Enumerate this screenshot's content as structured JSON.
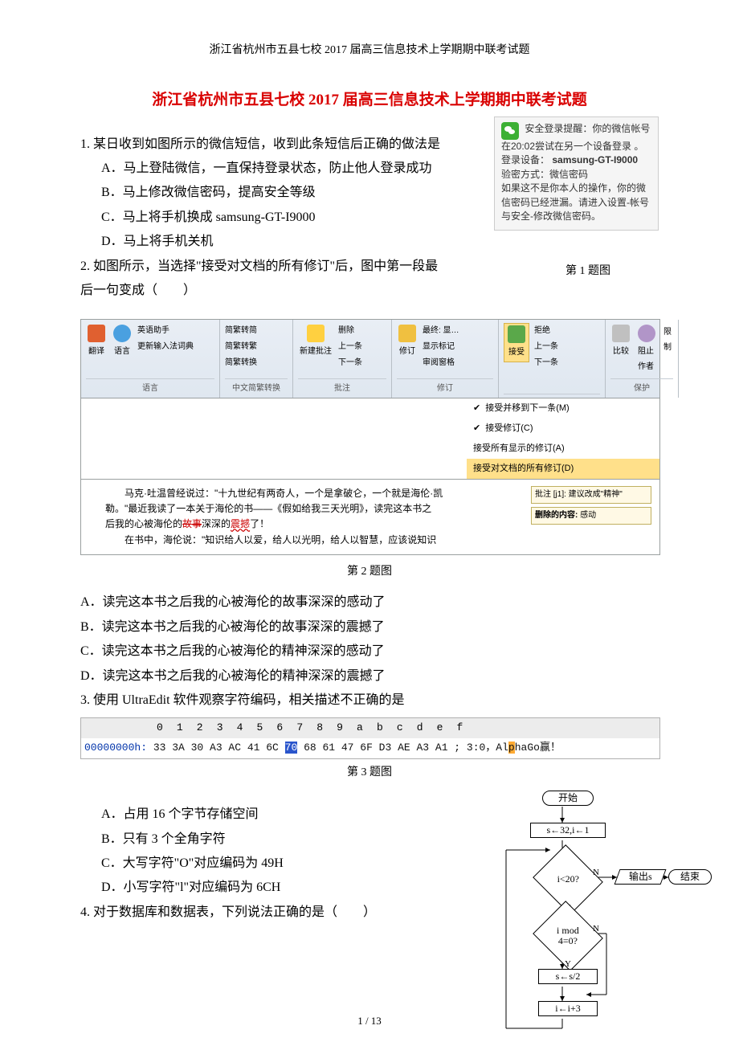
{
  "header": "浙江省杭州市五县七校 2017 届高三信息技术上学期期中联考试题",
  "title": "浙江省杭州市五县七校 2017 届高三信息技术上学期期中联考试题",
  "q1": {
    "stem": "1. 某日收到如图所示的微信短信，收到此条短信后正确的做法是",
    "A": "A．马上登陆微信，一直保持登录状态，防止他人登录成功",
    "B": "B．马上修改微信密码，提高安全等级",
    "C": "C．马上将手机换成 samsung-GT-I9000",
    "D": "D．马上将手机关机",
    "fig_caption": "第 1 题图"
  },
  "wechat": {
    "line1": "安全登录提醒：你的微信帐号在20:02尝试在另一个设备登录",
    "line1tail": "。",
    "deviceLabel": "登录设备：",
    "device": "samsung-GT-I9000",
    "method": "验密方式：微信密码",
    "warn": "如果这不是你本人的操作，你的微信密码已经泄漏。请进入设置-帐号与安全-修改微信密码。"
  },
  "q2": {
    "stem1": "2. 如图所示，当选择\"接受对文档的所有修订\"后，图中第一段最",
    "stem2": "后一句变成（　　）",
    "A": "A．读完这本书之后我的心被海伦的故事深深的感动了",
    "B": "B．读完这本书之后我的心被海伦的故事深深的震撼了",
    "C": "C．读完这本书之后我的心被海伦的精神深深的感动了",
    "D": "D．读完这本书之后我的心被海伦的精神深深的震撼了",
    "fig_caption": "第 2 题图"
  },
  "ribbon": {
    "translate": "翻译",
    "lang": "语言",
    "ime1": "英语助手",
    "ime2": "更新输入法词典",
    "grp_lang": "语言",
    "sc1": "简繁转简",
    "sc2": "简繁转繁",
    "sc3": "简繁转换",
    "grp_sc": "中文简繁转换",
    "newComment": "新建批注",
    "del": "删除",
    "prev": "上一条",
    "next": "下一条",
    "grp_comment": "批注",
    "track": "修订",
    "finalShow": "最终: 显…",
    "showMarkup": "显示标记",
    "reviewPane": "审阅窗格",
    "grp_track": "修订",
    "accept": "接受",
    "reject": "拒绝",
    "prev2": "上一条",
    "next2": "下一条",
    "compare": "比较",
    "block": "阻止作者",
    "restrict": "限制",
    "grp_protect": "保护",
    "menu1": "接受并移到下一条(M)",
    "menu2": "接受修订(C)",
    "menu3": "接受所有显示的修订(A)",
    "menu4": "接受对文档的所有修订(D)"
  },
  "docText": {
    "p1a": "马克·吐温曾经说过：\"十九世纪有两奇人，一个是拿破仑，一个就是海伦·凯",
    "p1b": "勒。\"最近我读了一本关于海伦的书——《假如给我三天光明》，读完这本书之",
    "p1c_pre": "后我的心被海伦的",
    "p1c_strike": "故事",
    "p1c_mid": "深深的",
    "p1c_wavy": "震撼",
    "p1c_end": "了！",
    "p2": "在书中，海伦说：\"知识给人以爱，给人以光明，给人以智慧，应该说知识",
    "balloon1": "批注 [j1]: 建议改成\"精神\"",
    "balloon2_label": "删除的内容:",
    "balloon2_val": "感动"
  },
  "q3": {
    "stem": "3. 使用 UltraEdit 软件观察字符编码，相关描述不正确的是",
    "ruler": "0  1  2  3  4  5  6  7  8  9  a  b  c  d  e  f",
    "addr": "00000000h:",
    "hex_before": " 33 3A 30 A3 AC 41 6C ",
    "hex_hl": "70",
    "hex_after": " 68 61 47 6F D3 AE A3 A1 ; ",
    "ascii_pre": "3:0，Al",
    "ascii_hl": "p",
    "ascii_post": "haGo赢！",
    "fig_caption": "第 3 题图",
    "A": "A．占用 16 个字节存储空间",
    "B": "B．只有 3 个全角字符",
    "C": "C．大写字符\"O\"对应编码为 49H",
    "D": "D．小写字符\"l\"对应编码为 6CH"
  },
  "q4": {
    "stem": "4. 对于数据库和数据表，下列说法正确的是（　　）"
  },
  "flow": {
    "start": "开始",
    "init": "s←32,i←1",
    "dec1": "i<20?",
    "out": "输出s",
    "end": "结束",
    "dec2": "i mod 4=0?",
    "proc1": "s←s/2",
    "proc2": "i←i+3",
    "Y": "Y",
    "N": "N"
  },
  "pageNum": "1 / 13"
}
